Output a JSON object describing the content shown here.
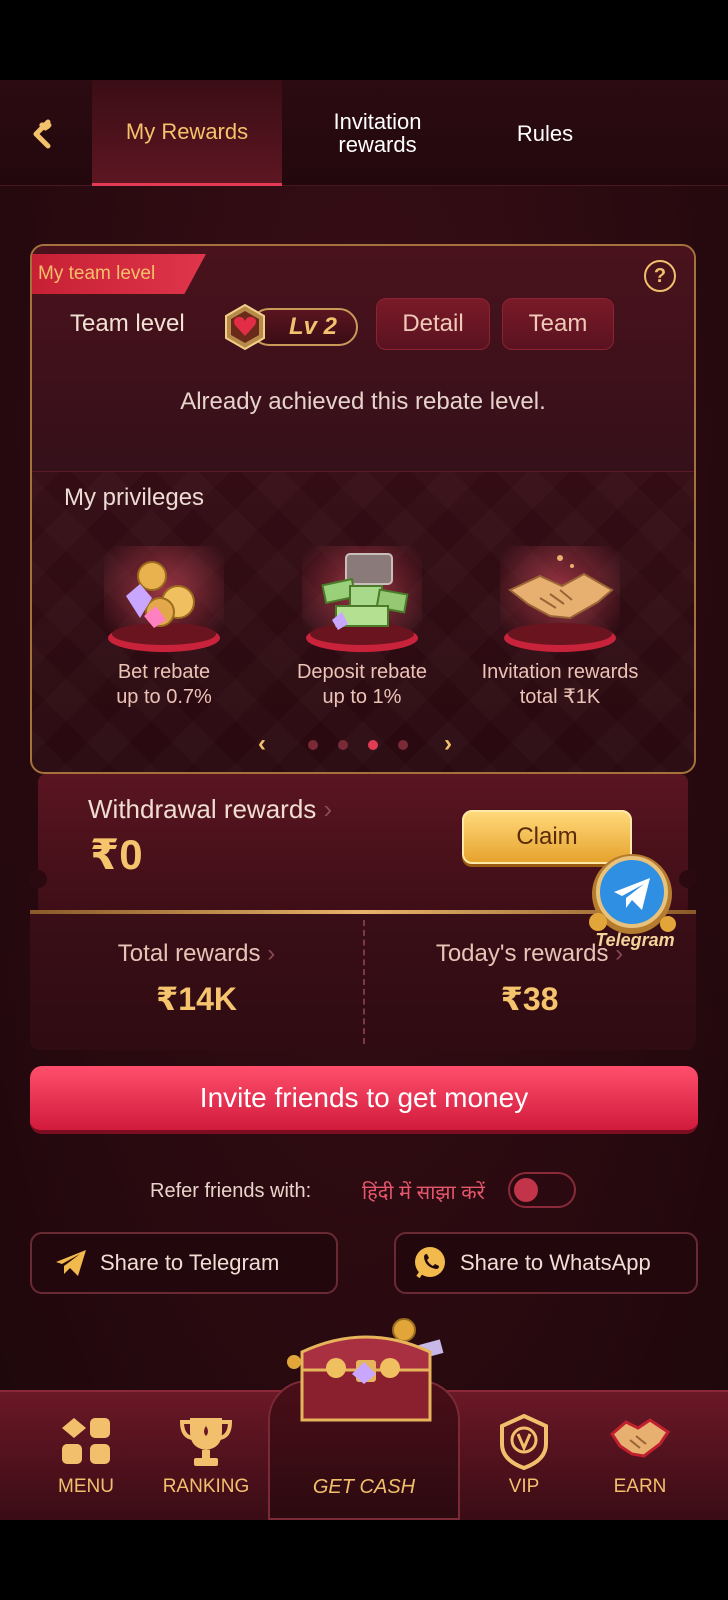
{
  "tabs": [
    {
      "label": "My Rewards",
      "active": true
    },
    {
      "label": "Invitation rewards",
      "active": false
    },
    {
      "label": "Rules",
      "active": false
    }
  ],
  "team": {
    "ribbon": "My team level",
    "level_label": "Team level",
    "level_value": "Lv 2",
    "detail_button": "Detail",
    "team_button": "Team",
    "achieved_text": "Already achieved this rebate level."
  },
  "privileges": {
    "title": "My privileges",
    "items": [
      {
        "line1": "Bet rebate",
        "line2": "up to 0.7%",
        "icon": "coins-gems-icon"
      },
      {
        "line1": "Deposit rebate",
        "line2": "up to 1%",
        "icon": "cash-chest-icon"
      },
      {
        "line1": "Invitation rewards",
        "line2": "total ₹1K",
        "icon": "handshake-icon"
      }
    ],
    "carousel_active_index": 2,
    "carousel_count": 4
  },
  "withdrawal": {
    "label": "Withdrawal rewards",
    "chevron": "›",
    "amount": "₹0",
    "claim_button": "Claim"
  },
  "totals": {
    "total_label": "Total rewards",
    "total_value": "₹14K",
    "today_label": "Today's rewards",
    "today_value": "₹38",
    "chevron": "›"
  },
  "telegram_float": {
    "caption": "Telegram"
  },
  "invite_button": "Invite friends to get money",
  "refer": {
    "label": "Refer friends with:",
    "hindi": "हिंदी में साझा करें",
    "toggle_on": false
  },
  "share": {
    "telegram": "Share to Telegram",
    "whatsapp": "Share to WhatsApp"
  },
  "nav": {
    "menu": "MENU",
    "ranking": "RANKING",
    "get_cash": "GET CASH",
    "vip": "VIP",
    "earn": "EARN"
  },
  "colors": {
    "accent_gold": "#f5c46d",
    "accent_red": "#e23c55",
    "background": "#2a0a10"
  }
}
